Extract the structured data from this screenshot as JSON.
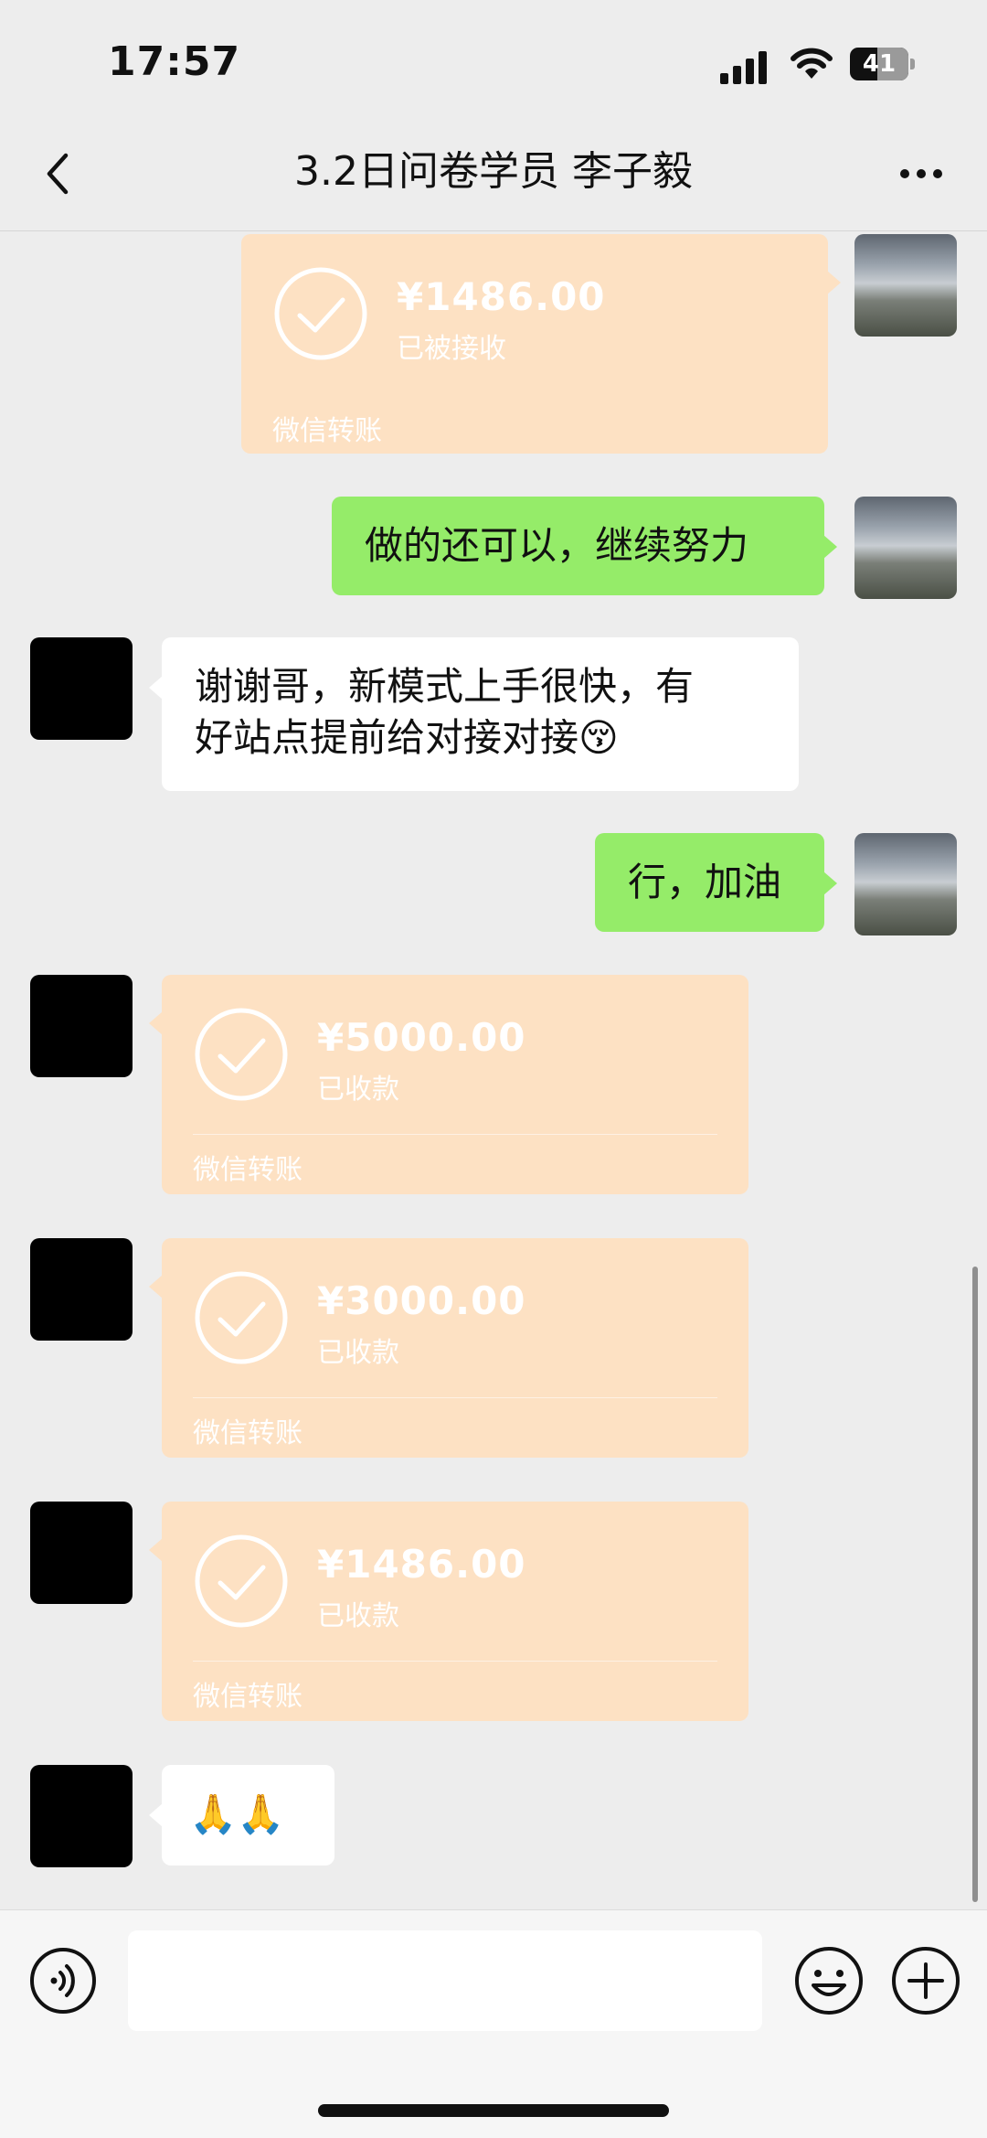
{
  "status_bar": {
    "time": "17:57",
    "battery": "41"
  },
  "header": {
    "title": "3.2日问卷学员 李子毅"
  },
  "messages": [
    {
      "type": "transfer",
      "side": "right",
      "amount": "¥1486.00",
      "status": "已被接收",
      "label": "微信转账"
    },
    {
      "type": "text",
      "side": "right",
      "text": "做的还可以，继续努力"
    },
    {
      "type": "text",
      "side": "left",
      "text": "谢谢哥，新模式上手很快，有\n好站点提前给对接对接😚"
    },
    {
      "type": "text",
      "side": "right",
      "text": "行，加油"
    },
    {
      "type": "transfer",
      "side": "left",
      "amount": "¥5000.00",
      "status": "已收款",
      "label": "微信转账"
    },
    {
      "type": "transfer",
      "side": "left",
      "amount": "¥3000.00",
      "status": "已收款",
      "label": "微信转账"
    },
    {
      "type": "transfer",
      "side": "left",
      "amount": "¥1486.00",
      "status": "已收款",
      "label": "微信转账"
    },
    {
      "type": "text",
      "side": "left",
      "text": "🙏🙏"
    }
  ],
  "colors": {
    "green_bubble": "#95ec69",
    "transfer_card": "#fde1c3",
    "background": "#ededed"
  },
  "icons": [
    "back-icon",
    "more-icon",
    "signal-icon",
    "wifi-icon",
    "voice-icon",
    "emoji-icon",
    "plus-icon",
    "check-circle-icon"
  ]
}
